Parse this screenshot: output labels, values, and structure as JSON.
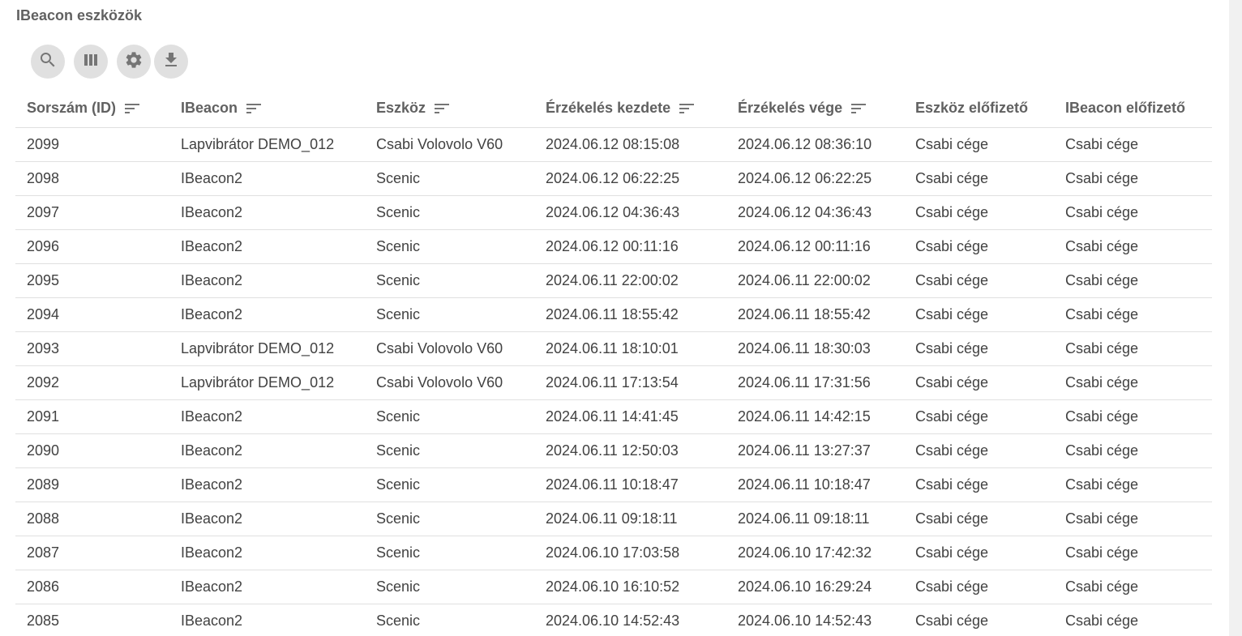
{
  "page": {
    "title": "IBeacon eszközök"
  },
  "toolbar": {
    "buttons": [
      {
        "icon": "search-icon"
      },
      {
        "icon": "columns-icon"
      },
      {
        "icon": "gear-icon"
      },
      {
        "icon": "download-icon"
      }
    ]
  },
  "table": {
    "columns": [
      {
        "label": "Sorszám (ID)",
        "sortable": true
      },
      {
        "label": "IBeacon",
        "sortable": true
      },
      {
        "label": "Eszköz",
        "sortable": true
      },
      {
        "label": "Érzékelés kezdete",
        "sortable": true
      },
      {
        "label": "Érzékelés vége",
        "sortable": true
      },
      {
        "label": "Eszköz előfizető",
        "sortable": false
      },
      {
        "label": "IBeacon előfizető",
        "sortable": false
      }
    ],
    "rows": [
      [
        "2099",
        "Lapvibrátor DEMO_012",
        "Csabi Volovolo V60",
        "2024.06.12 08:15:08",
        "2024.06.12 08:36:10",
        "Csabi cége",
        "Csabi cége"
      ],
      [
        "2098",
        "IBeacon2",
        "Scenic",
        "2024.06.12 06:22:25",
        "2024.06.12 06:22:25",
        "Csabi cége",
        "Csabi cége"
      ],
      [
        "2097",
        "IBeacon2",
        "Scenic",
        "2024.06.12 04:36:43",
        "2024.06.12 04:36:43",
        "Csabi cége",
        "Csabi cége"
      ],
      [
        "2096",
        "IBeacon2",
        "Scenic",
        "2024.06.12 00:11:16",
        "2024.06.12 00:11:16",
        "Csabi cége",
        "Csabi cége"
      ],
      [
        "2095",
        "IBeacon2",
        "Scenic",
        "2024.06.11 22:00:02",
        "2024.06.11 22:00:02",
        "Csabi cége",
        "Csabi cége"
      ],
      [
        "2094",
        "IBeacon2",
        "Scenic",
        "2024.06.11 18:55:42",
        "2024.06.11 18:55:42",
        "Csabi cége",
        "Csabi cége"
      ],
      [
        "2093",
        "Lapvibrátor DEMO_012",
        "Csabi Volovolo V60",
        "2024.06.11 18:10:01",
        "2024.06.11 18:30:03",
        "Csabi cége",
        "Csabi cége"
      ],
      [
        "2092",
        "Lapvibrátor DEMO_012",
        "Csabi Volovolo V60",
        "2024.06.11 17:13:54",
        "2024.06.11 17:31:56",
        "Csabi cége",
        "Csabi cége"
      ],
      [
        "2091",
        "IBeacon2",
        "Scenic",
        "2024.06.11 14:41:45",
        "2024.06.11 14:42:15",
        "Csabi cége",
        "Csabi cége"
      ],
      [
        "2090",
        "IBeacon2",
        "Scenic",
        "2024.06.11 12:50:03",
        "2024.06.11 13:27:37",
        "Csabi cége",
        "Csabi cége"
      ],
      [
        "2089",
        "IBeacon2",
        "Scenic",
        "2024.06.11 10:18:47",
        "2024.06.11 10:18:47",
        "Csabi cége",
        "Csabi cége"
      ],
      [
        "2088",
        "IBeacon2",
        "Scenic",
        "2024.06.11 09:18:11",
        "2024.06.11 09:18:11",
        "Csabi cége",
        "Csabi cége"
      ],
      [
        "2087",
        "IBeacon2",
        "Scenic",
        "2024.06.10 17:03:58",
        "2024.06.10 17:42:32",
        "Csabi cége",
        "Csabi cége"
      ],
      [
        "2086",
        "IBeacon2",
        "Scenic",
        "2024.06.10 16:10:52",
        "2024.06.10 16:29:24",
        "Csabi cége",
        "Csabi cége"
      ],
      [
        "2085",
        "IBeacon2",
        "Scenic",
        "2024.06.10 14:52:43",
        "2024.06.10 14:52:43",
        "Csabi cége",
        "Csabi cége"
      ]
    ]
  },
  "colors": {
    "header_text": "#616161",
    "cell_text": "#424242",
    "button_bg": "#e0e0e0",
    "icon": "#757575",
    "divider": "#e0e0e0"
  }
}
